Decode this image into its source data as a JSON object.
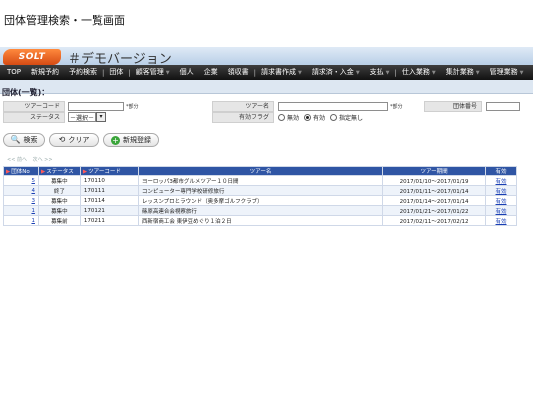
{
  "page": {
    "heading": "団体管理検索・一覧画面"
  },
  "header": {
    "logo_text": "SOLT",
    "demo_title": "＃デモバージョン"
  },
  "menu": {
    "items": [
      {
        "label": "TOP",
        "has_caret": false
      },
      {
        "label": "新規予約",
        "has_caret": false
      },
      {
        "label": "予約検索",
        "has_caret": false
      },
      {
        "label": "団体",
        "has_caret": false
      },
      {
        "label": "顧客管理",
        "has_caret": true
      },
      {
        "label": "個人",
        "has_caret": false
      },
      {
        "label": "企業",
        "has_caret": false
      },
      {
        "label": "領収書",
        "has_caret": false
      },
      {
        "label": "請求書作成",
        "has_caret": true
      },
      {
        "label": "請求済・入金",
        "has_caret": true
      },
      {
        "label": "支払",
        "has_caret": true
      },
      {
        "label": "仕入業務",
        "has_caret": true
      },
      {
        "label": "集計業務",
        "has_caret": true
      },
      {
        "label": "管理業務",
        "has_caret": true
      }
    ]
  },
  "section": {
    "title": "団体(一覧)："
  },
  "search_form": {
    "tour_code_label": "ツアーコード",
    "tour_code_value": "",
    "tour_code_note": "*部分",
    "tour_name_label": "ツアー名",
    "tour_name_value": "",
    "tour_name_note": "*部分",
    "group_number_label": "団体番号",
    "group_number_value": "",
    "status_label": "ステータス",
    "status_selected": "－選択－",
    "valid_flag_label": "有効フラグ",
    "valid_flag_options": [
      "無効",
      "有効",
      "指定無し"
    ],
    "valid_flag_selected_index": 1
  },
  "buttons": {
    "search": "検索",
    "clear": "クリア",
    "new": "新規登録"
  },
  "pager": {
    "prev": "<< 前へ",
    "next": "次へ >>"
  },
  "table": {
    "headers": {
      "group_no": "団体No",
      "status": "ステータス",
      "tour_code": "ツアーコード",
      "tour_name": "ツアー名",
      "tour_period": "ツアー期間",
      "valid": "有効"
    },
    "rows": [
      {
        "group_no": "5",
        "status": "募集中",
        "tour_code": "170110",
        "tour_name": "ヨーロッパ3都市グルメツアー１０日間",
        "tour_period": "2017/01/10～2017/01/19",
        "valid": "有効"
      },
      {
        "group_no": "4",
        "status": "終了",
        "tour_code": "170111",
        "tour_name": "コンピューター専門学校研修旅行",
        "tour_period": "2017/01/11～2017/01/14",
        "valid": "有効"
      },
      {
        "group_no": "3",
        "status": "募集中",
        "tour_code": "170114",
        "tour_name": "レッスンプロとラウンド（奥多摩ゴルフクラブ）",
        "tour_period": "2017/01/14～2017/01/14",
        "valid": "有効"
      },
      {
        "group_no": "1",
        "status": "募集中",
        "tour_code": "170121",
        "tour_name": "篠原高連合会視察旅行",
        "tour_period": "2017/01/21～2017/01/22",
        "valid": "有効"
      },
      {
        "group_no": "1",
        "status": "募集前",
        "tour_code": "170211",
        "tour_name": "西新宿商工会 東伊豆めぐり１泊２日",
        "tour_period": "2017/02/11～2017/02/12",
        "valid": "有効"
      }
    ]
  },
  "colors": {
    "table_header": "#2f55a4",
    "menu_bg": "#1f1f1f",
    "logo": "#e05a1c",
    "link": "#1a3fb4"
  }
}
